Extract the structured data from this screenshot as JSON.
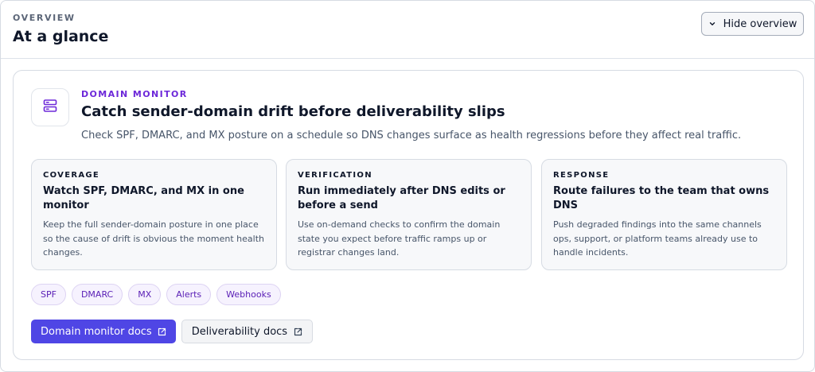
{
  "header": {
    "eyebrow": "OVERVIEW",
    "title": "At a glance",
    "hide_button_label": "Hide overview",
    "hide_button_icon": "chevron-down-icon"
  },
  "card": {
    "icon": "server-icon",
    "eyebrow": "DOMAIN MONITOR",
    "title": "Catch sender-domain drift before deliverability slips",
    "description": "Check SPF, DMARC, and MX posture on a schedule so DNS changes surface as health regressions before they affect real traffic.",
    "features": [
      {
        "label": "COVERAGE",
        "title": "Watch SPF, DMARC, and MX in one monitor",
        "text": "Keep the full sender-domain posture in one place so the cause of drift is obvious the moment health changes."
      },
      {
        "label": "VERIFICATION",
        "title": "Run immediately after DNS edits or before a send",
        "text": "Use on-demand checks to confirm the domain state you expect before traffic ramps up or registrar changes land."
      },
      {
        "label": "RESPONSE",
        "title": "Route failures to the team that owns DNS",
        "text": "Push degraded findings into the same channels ops, support, or platform teams already use to handle incidents."
      }
    ],
    "tags": [
      "SPF",
      "DMARC",
      "MX",
      "Alerts",
      "Webhooks"
    ],
    "actions": {
      "primary_label": "Domain monitor docs",
      "secondary_label": "Deliverability docs",
      "link_icon": "external-link-icon"
    }
  },
  "colors": {
    "accent": "#4f46e5",
    "eyebrow_purple": "#6d28d9",
    "tag_text": "#5b21b6",
    "tag_bg": "#f6f2fe"
  }
}
